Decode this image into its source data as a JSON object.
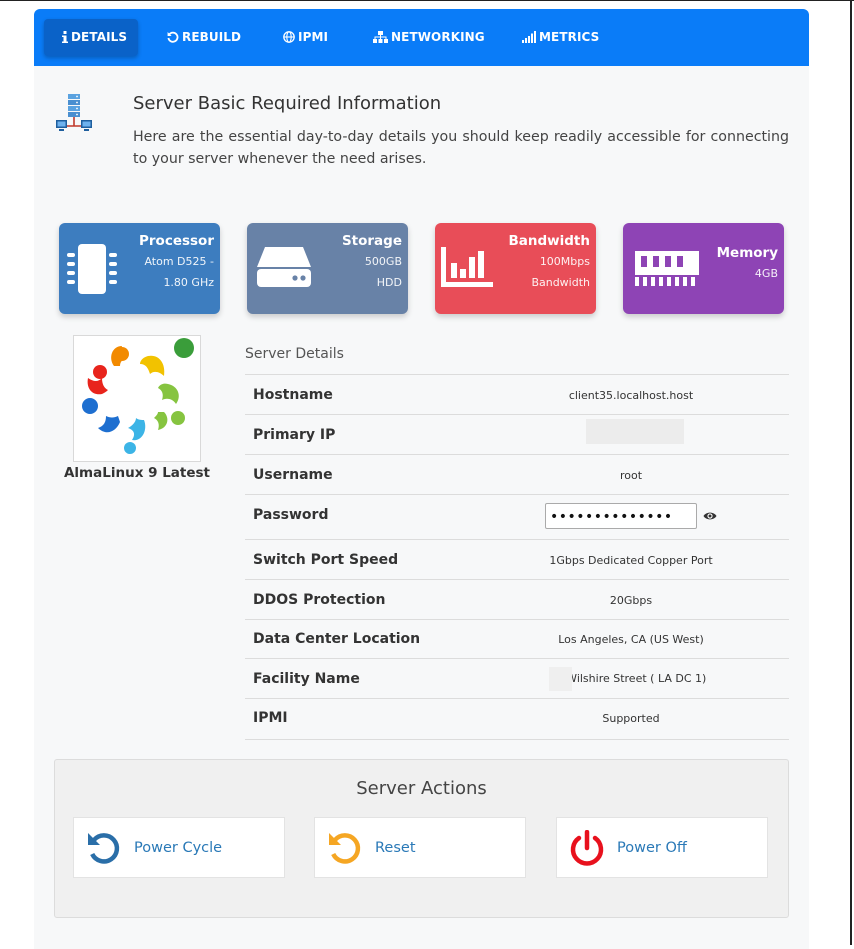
{
  "tabs": [
    {
      "label": "DETAILS",
      "icon": "info-icon",
      "active": true
    },
    {
      "label": "REBUILD",
      "icon": "rebuild-icon",
      "active": false
    },
    {
      "label": "IPMI",
      "icon": "globe-icon",
      "active": false
    },
    {
      "label": "NETWORKING",
      "icon": "network-icon",
      "active": false
    },
    {
      "label": "METRICS",
      "icon": "signal-bars-icon",
      "active": false
    }
  ],
  "intro": {
    "icon": "server-network-icon",
    "title": "Server Basic Required Information",
    "text": "Here are the essential day-to-day details you should keep readily accessible for connecting to your server whenever the need arises."
  },
  "cards": [
    {
      "title": "Processor",
      "line1": "Atom D525 -",
      "line2": "1.80 GHz",
      "color": "#3d7dbf",
      "icon": "chip-icon"
    },
    {
      "title": "Storage",
      "line1": "500GB",
      "line2": "HDD",
      "color": "#6882a7",
      "icon": "hard-drive-icon"
    },
    {
      "title": "Bandwidth",
      "line1": "100Mbps",
      "line2": "Bandwidth",
      "color": "#e84d58",
      "icon": "bar-chart-icon"
    },
    {
      "title": "Memory",
      "line1": "4GB",
      "line2": "",
      "color": "#8e44b5",
      "icon": "memory-icon"
    }
  ],
  "os": {
    "name": "AlmaLinux 9 Latest",
    "logo": "almalinux-logo"
  },
  "details": {
    "title": "Server Details",
    "rows": [
      {
        "label": "Hostname",
        "value": "client35.localhost.host"
      },
      {
        "label": "Primary IP",
        "value": ""
      },
      {
        "label": "Username",
        "value": "root"
      },
      {
        "label": "Password",
        "value": "••••••••••••••"
      },
      {
        "label": "Switch Port Speed",
        "value": "1Gbps Dedicated Copper Port"
      },
      {
        "label": "DDOS Protection",
        "value": "20Gbps"
      },
      {
        "label": "Data Center Location",
        "value": "Los Angeles, CA (US West)"
      },
      {
        "label": "Facility Name",
        "value": "0 Wilshire Street ( LA DC 1)"
      },
      {
        "label": "IPMI",
        "value": "Supported"
      }
    ]
  },
  "actions": {
    "title": "Server Actions",
    "buttons": [
      {
        "label": "Power Cycle",
        "icon": "power-cycle-icon",
        "color": "#2a6ea8"
      },
      {
        "label": "Reset",
        "icon": "reset-icon",
        "color": "#f5a623"
      },
      {
        "label": "Power Off",
        "icon": "power-off-icon",
        "color": "#e8111d"
      }
    ]
  }
}
